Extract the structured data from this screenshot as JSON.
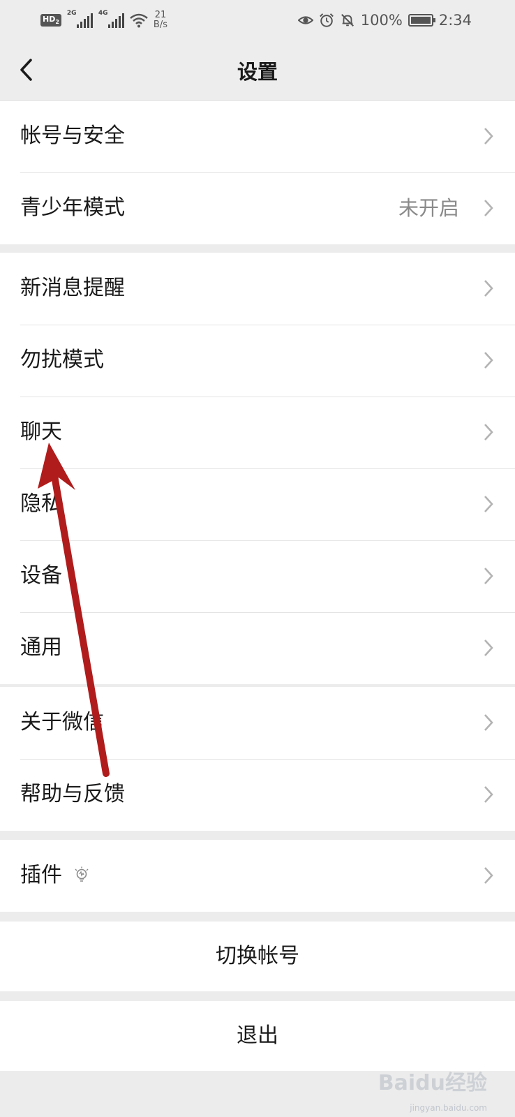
{
  "status_bar": {
    "hd_label": "HD",
    "hd_sub": "2",
    "sim1_gen": "2G",
    "sim2_gen": "4G",
    "speed_value": "21",
    "speed_unit": "B/s",
    "battery": "100%",
    "time": "2:34"
  },
  "nav": {
    "title": "设置",
    "back_icon": "chevron-left-icon"
  },
  "groups": [
    [
      {
        "label": "帐号与安全",
        "value": ""
      },
      {
        "label": "青少年模式",
        "value": "未开启"
      }
    ],
    [
      {
        "label": "新消息提醒"
      },
      {
        "label": "勿扰模式"
      },
      {
        "label": "聊天"
      },
      {
        "label": "隐私"
      },
      {
        "label": "设备"
      },
      {
        "label": "通用"
      }
    ],
    [
      {
        "label": "关于微信"
      },
      {
        "label": "帮助与反馈"
      }
    ],
    [
      {
        "label": "插件",
        "icon": "lightbulb-icon"
      }
    ]
  ],
  "actions": {
    "switch_account": "切换帐号",
    "logout": "退出"
  },
  "annotation": {
    "color": "#b01c1c",
    "target": "聊天"
  },
  "watermark": {
    "text": "Baidu经验",
    "sub": "jingyan.baidu.com"
  }
}
